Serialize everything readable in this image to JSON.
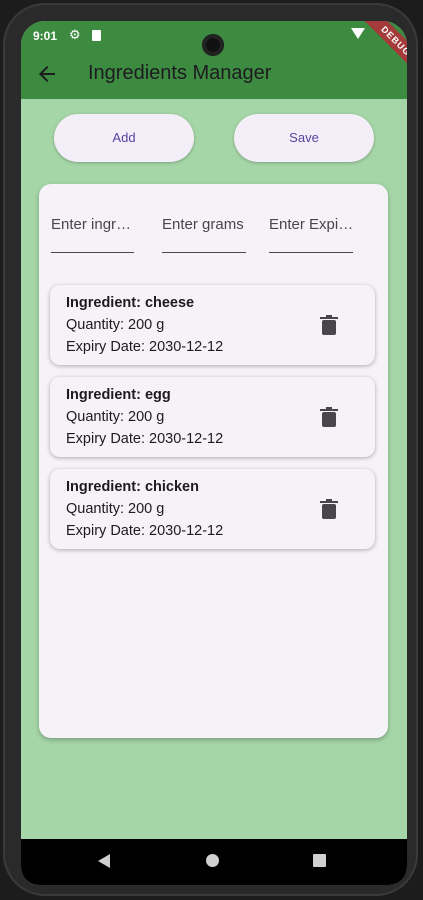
{
  "status_bar": {
    "time": "9:01"
  },
  "app_bar": {
    "title": "Ingredients Manager",
    "debug_banner": "DEBUG"
  },
  "actions": {
    "add_label": "Add",
    "save_label": "Save"
  },
  "form": {
    "ingredient_placeholder": "Enter ingr…",
    "grams_placeholder": "Enter grams",
    "expiry_placeholder": "Enter Expi…"
  },
  "ingredients": [
    {
      "name": "Ingredient: cheese",
      "quantity": "Quantity: 200 g",
      "expiry": "Expiry Date: 2030-12-12"
    },
    {
      "name": "Ingredient: egg",
      "quantity": "Quantity: 200 g",
      "expiry": "Expiry Date: 2030-12-12"
    },
    {
      "name": "Ingredient: chicken",
      "quantity": "Quantity: 200 g",
      "expiry": "Expiry Date: 2030-12-12"
    }
  ],
  "colors": {
    "app_bar": "#3d8b41",
    "background": "#a5d6a7",
    "card": "#f5f2f8",
    "button_text": "#5a45a0"
  },
  "icons": [
    "back-arrow-icon",
    "gear-icon",
    "sd-card-icon",
    "wifi-icon",
    "battery-icon",
    "trash-icon"
  ]
}
